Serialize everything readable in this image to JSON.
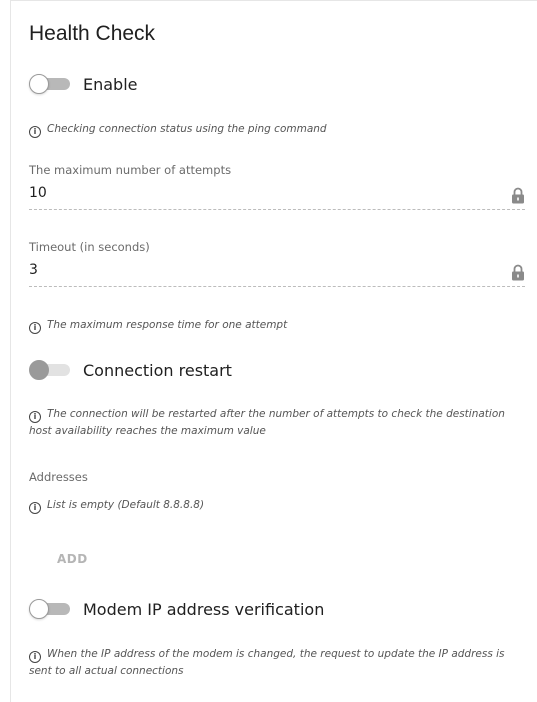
{
  "section": {
    "title": "Health Check"
  },
  "enable": {
    "label": "Enable",
    "checked": false,
    "disabled": false
  },
  "enable_hint": "Checking connection status using the ping command",
  "max_attempts": {
    "label": "The maximum number of attempts",
    "value": "10",
    "locked": true
  },
  "timeout": {
    "label": "Timeout (in seconds)",
    "value": "3",
    "locked": true
  },
  "timeout_hint": "The maximum response time for one attempt",
  "connection_restart": {
    "label": "Connection restart",
    "checked": false,
    "disabled": true
  },
  "connection_restart_hint": "The connection will be restarted after the number of attempts to check the destination host availability reaches the maximum value",
  "addresses": {
    "label": "Addresses",
    "empty_hint": "List is empty (Default 8.8.8.8)",
    "add_label": "ADD"
  },
  "modem_ip": {
    "label": "Modem IP address verification",
    "checked": false,
    "disabled": false
  },
  "modem_ip_hint": "When the IP address of the modem is changed, the request to update the IP address is sent to all actual connections",
  "icons": {
    "info": "info-icon",
    "lock": "lock-icon"
  },
  "colors": {
    "text": "#202020",
    "hint": "#555555",
    "muted_button": "#b5b5b5",
    "toggle_track": "#b8b8b8"
  }
}
